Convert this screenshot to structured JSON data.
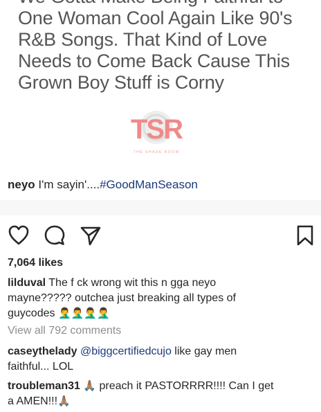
{
  "post_image": {
    "quote_lines": [
      "We Gotta Make Being Faithful to",
      "One Woman Cool Again Like 90's",
      "R&B Songs. That Kind of Love",
      "Needs to Come Back Cause This",
      "Grown Boy Stuff is Corny"
    ],
    "logo_text": "TSR",
    "logo_tagline": "THE SHADE ROOM",
    "colors": {
      "logo": "#f08a8a",
      "logo_dark": "#d96b6b",
      "quote_text": "#555555"
    }
  },
  "caption": {
    "username": "neyo",
    "text": " I'm sayin'....",
    "hashtag": "#GoodManSeason"
  },
  "actions": {
    "like_icon": "heart-icon",
    "comment_icon": "comment-icon",
    "share_icon": "share-icon",
    "save_icon": "bookmark-icon"
  },
  "likes": "7,064 likes",
  "comments": [
    {
      "username": "lilduval",
      "text_line1": " The f  ck wrong wit this n  gga neyo",
      "text_line2": "mayne????? outchea just breaking all types of",
      "text_line3": "guycodes ",
      "emojis": "🤦‍♂️🤦‍♂️🤦‍♂️🤦‍♂️"
    },
    {
      "username": "caseythelady",
      "mention": "@biggcertifiedcujo",
      "text_line1": " like gay men",
      "text_line2": "faithful... LOL"
    },
    {
      "username": "troubleman31",
      "emoji1": "🙏🏽",
      "text_line1": " preach it PASTORRRR!!!! Can I get",
      "text_line2": "a AMEN!!!",
      "emoji2": "🙏🏽"
    }
  ],
  "view_all": "View all 792 comments",
  "accent_color": "#1a3a7a"
}
